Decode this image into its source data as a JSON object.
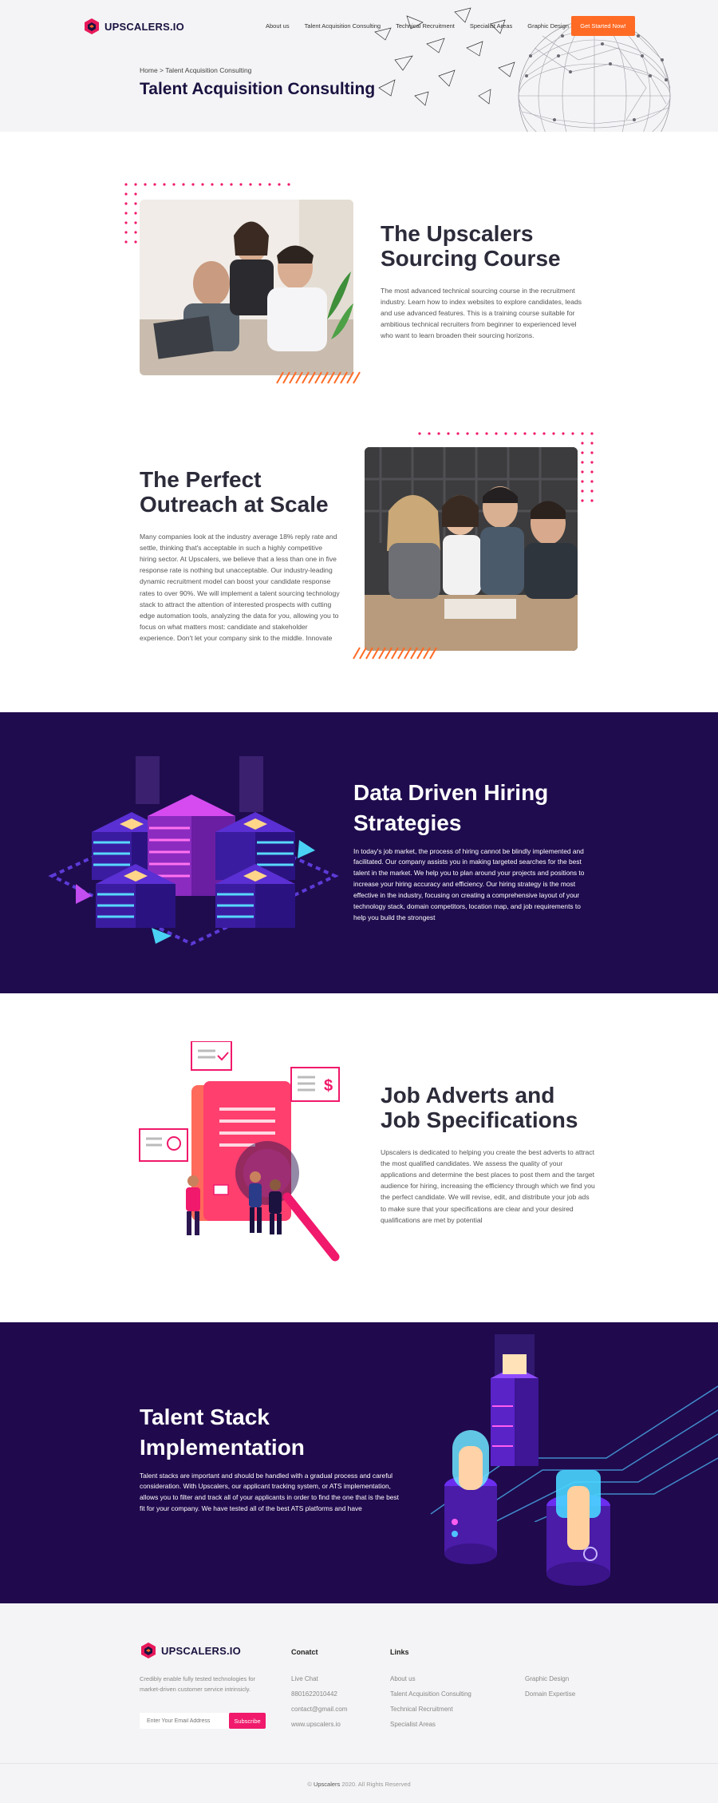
{
  "brand": {
    "name": "UPSCALERS.IO",
    "accent": "#ff6a24",
    "pink": "#f0196b",
    "purple": "#1f0c4e"
  },
  "nav": {
    "links": [
      "About us",
      "Talent Acquisition Consulting",
      "Technical Recruitment",
      "Specialist Areas",
      "Graphic Design"
    ],
    "cta": "Get Started Now!"
  },
  "hero": {
    "breadcrumb": "Home > Talent Acquisition Consulting",
    "title": "Talent Acquisition Consulting"
  },
  "sections": {
    "sourcing": {
      "title_1": "The Upscalers",
      "title_2": "Sourcing Course",
      "text": "The most advanced technical sourcing course in the recruitment industry. Learn how to index websites to explore candidates, leads and use advanced features. This is a training course suitable for ambitious technical recruiters from beginner to experienced level who want to learn broaden their sourcing horizons."
    },
    "outreach": {
      "title_1": "The Perfect",
      "title_2": "Outreach at Scale",
      "text": "Many companies look at the industry average 18% reply rate and settle, thinking that's acceptable in such a highly competitive hiring sector. At Upscalers, we believe that a less than one in five response rate is nothing but unacceptable. Our industry-leading dynamic recruitment model can boost your candidate response rates to over 90%. We will implement a talent sourcing technology stack to attract the attention of interested prospects with cutting edge automation tools, analyzing the data for you, allowing you to focus on what matters most: candidate and stakeholder experience. Don't let your company sink to the middle. Innovate"
    },
    "data_driven": {
      "title_1": "Data Driven Hiring",
      "title_2": "Strategies",
      "text": "In today's job market, the process of hiring cannot be blindly implemented and facilitated. Our company assists you in making targeted searches for the best talent in the market. We help you to plan around your projects and positions to increase your hiring accuracy and efficiency. Our hiring strategy is the most effective in the industry, focusing on creating a comprehensive layout of your technology stack, domain competitors, location map, and job requirements to help you build the strongest"
    },
    "job_adverts": {
      "title_1": "Job Adverts and",
      "title_2": "Job Specifications",
      "text": "Upscalers is dedicated to helping you create the best adverts to attract the most qualified candidates. We assess the quality of your applications and determine the best places to post them and the target audience for hiring, increasing the efficiency through which we find you the perfect candidate. We will revise, edit, and distribute your job ads to make sure that your specifications are clear and your desired qualifications are met by potential"
    },
    "talent_stack": {
      "title_1": "Talent Stack",
      "title_2": "Implementation",
      "text": "Talent stacks are important and should be handled with a gradual process and careful consideration. With Upscalers, our applicant tracking system, or ATS implementation, allows you to filter and track all of your applicants in order to find the one that is the best fit for your company. We have tested all of the best ATS platforms and have"
    }
  },
  "footer": {
    "tagline": "Credibly enable fully tested technologies for market-driven customer service intrinsicly.",
    "subscribe_placeholder": "Enter Your Email Address",
    "subscribe_button": "Subscribe",
    "contact_heading": "Conatct",
    "contact_items": [
      "Live Chat",
      "8801622010442",
      "contact@gmail.com",
      "www.upscalers.io"
    ],
    "links_heading": "Links",
    "links_col1": [
      "About us",
      "Talent Acquisition Consulting",
      "Technical Recruitment",
      "Specialist Areas"
    ],
    "links_col2": [
      "Graphic Design",
      "Domain Expertise"
    ],
    "copyright_brand": "Upscalers",
    "copyright_rest": " 2020. All Rights Reserved"
  }
}
